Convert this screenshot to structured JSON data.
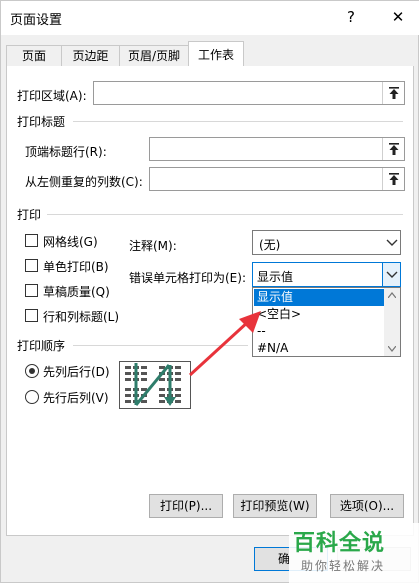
{
  "window": {
    "title": "页面设置",
    "help_label": "?",
    "close_label": "✕"
  },
  "tabs": [
    {
      "label": "页面"
    },
    {
      "label": "页边距"
    },
    {
      "label": "页眉/页脚"
    },
    {
      "label": "工作表"
    }
  ],
  "print_area": {
    "label": "打印区域(A):",
    "value": ""
  },
  "print_titles": {
    "heading": "打印标题",
    "rows_label": "顶端标题行(R):",
    "rows_value": "",
    "cols_label": "从左侧重复的列数(C):",
    "cols_value": ""
  },
  "print": {
    "heading": "打印",
    "gridlines": {
      "label": "网格线(G)",
      "checked": false
    },
    "bw": {
      "label": "单色打印(B)",
      "checked": false
    },
    "draft": {
      "label": "草稿质量(Q)",
      "checked": false
    },
    "headings": {
      "label": "行和列标题(L)",
      "checked": false
    },
    "comments_label": "注释(M):",
    "comments_value": "(无)",
    "errors_label": "错误单元格打印为(E):",
    "errors_value": "显示值",
    "errors_options": [
      "显示值",
      "<空白>",
      "--",
      "#N/A"
    ]
  },
  "page_order": {
    "heading": "打印顺序",
    "down_over": {
      "label": "先列后行(D)",
      "selected": true
    },
    "over_down": {
      "label": "先行后列(V)",
      "selected": false
    }
  },
  "buttons": {
    "print": "打印(P)...",
    "preview": "打印预览(W)",
    "options": "选项(O)...",
    "ok": "确"
  },
  "watermark": {
    "title": "百科全说",
    "subtitle": "助你轻松解决"
  },
  "colors": {
    "accent": "#0078d7",
    "annotation_arrow": "#e8333b",
    "watermark_green": "#2aa84a"
  }
}
